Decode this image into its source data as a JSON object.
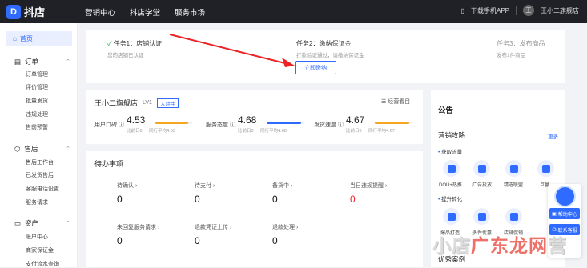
{
  "header": {
    "logo_text": "抖店",
    "logo_mark": "D",
    "nav": [
      "营销中心",
      "抖店学堂",
      "服务市场"
    ],
    "download": "下载手机APP",
    "avatar_text": "王",
    "shop_name": "王小二旗舰店"
  },
  "sidebar": {
    "home": "首页",
    "groups": [
      {
        "label": "订单",
        "items": [
          "订单管理",
          "评价管理",
          "批量发货",
          "违规处理",
          "售前预警"
        ]
      },
      {
        "label": "售后",
        "items": [
          "售后工作台",
          "已发货售后",
          "客服电话设置",
          "服务请求"
        ]
      },
      {
        "label": "资产",
        "items": [
          "账户中心",
          "商家保证金",
          "支付流水查询"
        ]
      }
    ]
  },
  "tasks": [
    {
      "title": "任务1：店铺认证",
      "sub": "您的店铺已认证"
    },
    {
      "title": "任务2：缴纳保证金",
      "sub": "打款验证通过，请缴纳保证金"
    },
    {
      "title": "任务3：发布商品",
      "sub": "发布1件商品"
    }
  ],
  "pay_button": "立即缴纳",
  "shop": {
    "name": "王小二旗舰店",
    "level": "LV1",
    "badge": "入驻中",
    "manage": "经营看目",
    "metrics": [
      {
        "label": "用户口碑",
        "value": "4.53",
        "compare": "比前日0 一",
        "peer": "同行平均4.53",
        "color": "#f5a623",
        "fill": 0.9
      },
      {
        "label": "服务态度",
        "value": "4.68",
        "compare": "比前日0 一",
        "peer": "同行平均4.68",
        "color": "#2f6bff",
        "fill": 0.94
      },
      {
        "label": "发货速度",
        "value": "4.67",
        "compare": "比前日0 一",
        "peer": "同行平均4.67",
        "color": "#f5a623",
        "fill": 0.93
      }
    ]
  },
  "todo": {
    "title": "待办事项",
    "items": [
      {
        "label": "待确认 ›",
        "value": "0"
      },
      {
        "label": "待支付 ›",
        "value": "0"
      },
      {
        "label": "备货中 ›",
        "value": "0"
      },
      {
        "label": "当日违规提醒 ›",
        "value": "0"
      },
      {
        "label": "未回复服务请求 ›",
        "value": "0"
      },
      {
        "label": "退款凭证上传 ›",
        "value": "0"
      },
      {
        "label": "退款处理 ›",
        "value": "0"
      }
    ]
  },
  "right": {
    "notice": "公告",
    "strategy": "营销攻略",
    "more": "更多",
    "sec1": "获取流量",
    "icons1": [
      "DOU+热推",
      "广告投放",
      "精选联盟",
      "巨量"
    ],
    "sec2": "提升转化",
    "icons2": [
      "爆品打造",
      "多件优惠",
      "店铺促销"
    ],
    "cases": "优秀案例"
  },
  "float": {
    "help": "帮助中心",
    "contact": "联系客服"
  },
  "watermark": {
    "a": "小店",
    "b": "广东龙网",
    "c": "营"
  }
}
